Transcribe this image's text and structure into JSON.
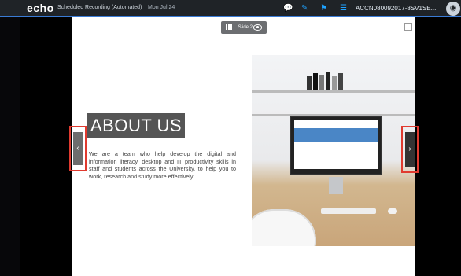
{
  "topbar": {
    "brand": "echo",
    "title": "Scheduled Recording (Automated)",
    "date": "Mon Jul 24",
    "icons": [
      "chat-icon",
      "annotate-icon",
      "flag-icon",
      "list-icon"
    ],
    "course": "ACCN080092017-8SV1SE...",
    "user_icon": "user-avatar-icon"
  },
  "slide_nav": {
    "label": "Slide 2",
    "prev": "‹",
    "next": "›"
  },
  "slide": {
    "heading": "ABOUT US",
    "body": "We are a team who help develop the digital and information literacy, desktop and IT productivity skills in staff and students across the University, to help you to work, research and study more effectively."
  },
  "colors": {
    "accent": "#3a7bd5",
    "highlight": "#e03a2f"
  }
}
